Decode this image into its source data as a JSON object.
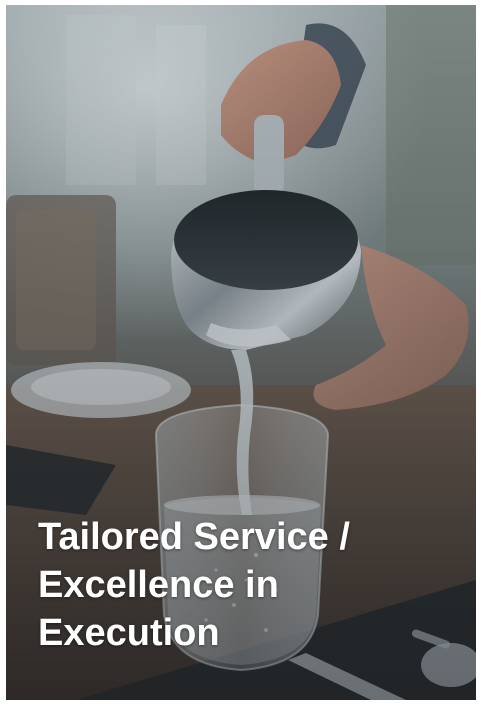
{
  "card": {
    "caption_lines": [
      "Tailored Service /",
      "Excellence in",
      "Execution"
    ],
    "image_subject": "waiter-pouring-water-photo"
  },
  "colors": {
    "caption_text": "#ffffff",
    "overlay_tint": "#3f454a"
  }
}
